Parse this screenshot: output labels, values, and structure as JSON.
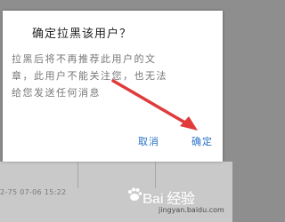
{
  "background": {
    "timestamp": "2-75  07-06 15:22"
  },
  "dialog": {
    "title": "确定拉黑该用户？",
    "message_lines": [
      "拉黑后将不再推荐此用户的文",
      "章，此用户不能关注您，也无法",
      "给您发送任何消息"
    ],
    "cancel_label": "取消",
    "confirm_label": "确定",
    "button_color": "#2a72c7"
  },
  "annotation": {
    "arrow_color": "#e03a3a"
  },
  "watermark": {
    "brand": "Bai 经验",
    "url": "jingyan.baidu.com"
  }
}
